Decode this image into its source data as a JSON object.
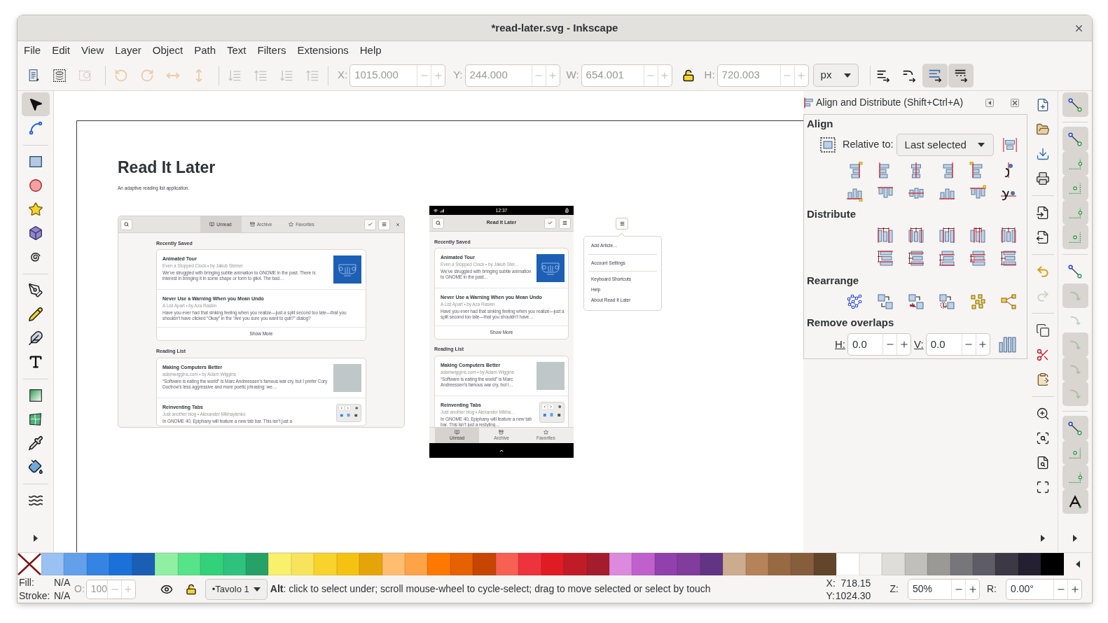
{
  "window": {
    "title": "*read-later.svg - Inkscape"
  },
  "menu": [
    "File",
    "Edit",
    "View",
    "Layer",
    "Object",
    "Path",
    "Text",
    "Filters",
    "Extensions",
    "Help"
  ],
  "toolbar": {
    "rotate_flip": {
      "disabled": true
    },
    "z_order": {
      "disabled": true
    },
    "fields": [
      {
        "label": "X:",
        "value": "1015.000"
      },
      {
        "label": "Y:",
        "value": "244.000"
      },
      {
        "label": "W:",
        "value": "654.001"
      },
      {
        "label": "H:",
        "value": "720.003"
      }
    ],
    "ratio_locked": false,
    "unit": "px",
    "transform_toggles": [
      {
        "on": false
      },
      {
        "on": false
      },
      {
        "on": true
      },
      {
        "on": true
      }
    ]
  },
  "tools": [
    {
      "selected": true
    },
    {
      "selected": false
    },
    {
      "selected": false
    },
    {
      "selected": false
    },
    {
      "selected": false
    },
    {
      "selected": false
    },
    {
      "selected": false
    },
    {
      "selected": false
    },
    {
      "selected": false
    },
    {
      "selected": false
    },
    {
      "selected": false
    },
    {
      "selected": false
    },
    {
      "selected": false
    },
    {
      "selected": false
    },
    {
      "selected": false
    },
    {
      "selected": false
    }
  ],
  "canvas": {
    "heading": "Read It Later",
    "subtitle": "An adaptive reading list application.",
    "desktop_mockup": {
      "tabs": [
        {
          "label": "Unread",
          "selected": true
        },
        {
          "label": "Archive",
          "selected": false
        },
        {
          "label": "Favorites",
          "selected": false
        }
      ],
      "sections": [
        {
          "title": "Recently Saved",
          "articles": [
            {
              "title": "Animated Tour",
              "meta": "Even a Stopped Clock • by Jakub Steiner",
              "excerpt": "We’ve struggled with bringing subtle animation to GNOME in the past. There is interest in bringing it in some shape or form to gtk4. The bad…",
              "thumbnail": {
                "kind": "illustration"
              }
            },
            {
              "title": "Never Use a Warning When you Mean Undo",
              "meta": "A List Apart • by Aza Raskin",
              "excerpt": "Have you ever had that sinking feeling when you realize—just a split second too late—that you shouldn’t have clicked “Okay” in the “Are you sure you want to quit?” dialog?"
            }
          ],
          "more": "Show More"
        },
        {
          "title": "Reading List",
          "articles": [
            {
              "title": "Making Computers Better",
              "meta": "adamwiggins.com • by Adam Wiggins",
              "excerpt": "“Software is eating the world” is Marc Andreessen’s famous war cry, but I prefer Cory Doctrow’s less aggressive and more poetic phrasing: we…",
              "thumbnail": {
                "kind": "photo"
              }
            },
            {
              "title": "Reinventing Tabs",
              "meta": "Just another blog • Alexander Mikhaylenko",
              "excerpt": "In GNOME 40, Epiphany will feature a new tab bar. This isn’t just a",
              "thumbnail": {
                "kind": "screenshot"
              }
            }
          ]
        }
      ]
    },
    "phone_mockup": {
      "time": "12:37",
      "title": "Read It Later",
      "sections": [
        {
          "title": "Recently Saved",
          "articles": [
            {
              "title": "Animated Tour",
              "meta": "Even a Stopped Clock • by Jakub Stei…",
              "excerpt": "We’ve struggled with bringing subtle animation to GNOME in the past…",
              "thumbnail": {
                "kind": "illustration"
              }
            },
            {
              "title": "Never Use a Warning When you Mean Undo",
              "meta": "A List Apart • by Aza Raskin",
              "excerpt": "Have you ever had that sinking feeling when you realize—just a split second too late—that you shouldn’t have…"
            }
          ],
          "more": "Show More"
        },
        {
          "title": "Reading List",
          "articles": [
            {
              "title": "Making Computers Better",
              "meta": "adamwiggins.com • by Adam Wiggins",
              "excerpt": "“Software is eating the world” is Marc Andreessen’s famous war cry, but I…",
              "thumbnail": {
                "kind": "photo"
              }
            },
            {
              "title": "Reinventing Tabs",
              "meta": "Just another blog • Alexander Mikha…",
              "excerpt": "In GNOME 40, Epiphany will feature a new tab bar. This isn’t just a restyling…",
              "thumbnail": {
                "kind": "screenshot"
              }
            }
          ]
        }
      ],
      "tabs": [
        {
          "label": "Unread",
          "selected": true
        },
        {
          "label": "Archive",
          "selected": false
        },
        {
          "label": "Favorites",
          "selected": false
        }
      ]
    },
    "popover_menu": {
      "groups": [
        [
          "Add Article…"
        ],
        [
          "Account Settings"
        ],
        [
          "Keyboard Shortcuts",
          "Help",
          "About Read It Later"
        ]
      ]
    }
  },
  "align_panel": {
    "title": "Align and Distribute (Shift+Ctrl+A)",
    "align_heading": "Align",
    "relative_label": "Relative to:",
    "relative_value": "Last selected",
    "distribute_heading": "Distribute",
    "rearrange_heading": "Rearrange",
    "overlaps_heading": "Remove overlaps",
    "h_label": "H:",
    "h_value": "0.0",
    "v_label": "V:",
    "v_value": "0.0"
  },
  "commands": [
    {
      "disabled": false
    },
    {
      "disabled": false
    },
    {
      "disabled": false
    },
    {
      "disabled": false
    },
    {
      "disabled": false
    },
    {
      "disabled": false
    },
    {
      "disabled": false
    },
    {
      "disabled": true
    },
    {
      "disabled": false
    },
    {
      "disabled": false
    },
    {
      "disabled": false
    },
    {
      "disabled": false
    },
    {
      "disabled": false
    },
    {
      "disabled": false
    },
    {
      "disabled": false
    }
  ],
  "snap": [
    {
      "on": true,
      "disabled": false
    },
    {
      "on": true,
      "disabled": false
    },
    {
      "on": true,
      "disabled": false
    },
    {
      "on": true,
      "disabled": false
    },
    {
      "on": true,
      "disabled": false
    },
    {
      "on": true,
      "disabled": false
    },
    {
      "on": false,
      "disabled": false
    },
    {
      "on": true,
      "disabled": true
    },
    {
      "on": false,
      "disabled": true
    },
    {
      "on": true,
      "disabled": true
    },
    {
      "on": true,
      "disabled": true
    },
    {
      "on": true,
      "disabled": true
    },
    {
      "on": true,
      "disabled": false
    },
    {
      "on": true,
      "disabled": false
    },
    {
      "on": true,
      "disabled": false
    },
    {
      "on": true,
      "disabled": false
    }
  ],
  "palette": {
    "swatches": [
      {
        "color": "#99c1f1"
      },
      {
        "color": "#62a0ea"
      },
      {
        "color": "#3584e4"
      },
      {
        "color": "#1c71d8"
      },
      {
        "color": "#1a5fb4"
      },
      {
        "color": "#8ff0a4"
      },
      {
        "color": "#57e389"
      },
      {
        "color": "#33d17a"
      },
      {
        "color": "#2ec27e"
      },
      {
        "color": "#26a269"
      },
      {
        "color": "#f9f06b"
      },
      {
        "color": "#f8e45c"
      },
      {
        "color": "#f6d32d"
      },
      {
        "color": "#f5c211"
      },
      {
        "color": "#e5a50a"
      },
      {
        "color": "#ffbe6f"
      },
      {
        "color": "#ffa348"
      },
      {
        "color": "#ff7800"
      },
      {
        "color": "#e66100"
      },
      {
        "color": "#c64600"
      },
      {
        "color": "#f66151"
      },
      {
        "color": "#ed333b"
      },
      {
        "color": "#e01b24"
      },
      {
        "color": "#c01c28"
      },
      {
        "color": "#a51d2d"
      },
      {
        "color": "#dc8add"
      },
      {
        "color": "#c061cb"
      },
      {
        "color": "#9141ac"
      },
      {
        "color": "#813d9c"
      },
      {
        "color": "#613583"
      },
      {
        "color": "#cdab8f"
      },
      {
        "color": "#b5835a"
      },
      {
        "color": "#986a44"
      },
      {
        "color": "#865e3c"
      },
      {
        "color": "#63452c"
      },
      {
        "color": "#ffffff"
      },
      {
        "color": "#f6f5f4"
      },
      {
        "color": "#deddda"
      },
      {
        "color": "#c0bfbc"
      },
      {
        "color": "#9a9996"
      },
      {
        "color": "#77767b"
      },
      {
        "color": "#5e5c64"
      },
      {
        "color": "#3d3846"
      },
      {
        "color": "#241f31"
      },
      {
        "color": "#000000"
      }
    ]
  },
  "status_bar": {
    "fill_label": "Fill:",
    "fill_value": "N/A",
    "stroke_label": "Stroke:",
    "stroke_value": "N/A",
    "opacity_label": "O:",
    "opacity_value": "100",
    "opacity_disabled": true,
    "layer_hidden": false,
    "layer_locked": false,
    "layer": "•Tavolo 1",
    "message": "**Alt**: click to select under; scroll mouse-wheel to cycle-select; drag to move selected or select by touch",
    "x_label": "X:",
    "x_value": "718.15",
    "y_label": "Y:",
    "y_value": "1024.30",
    "zoom_label": "Z:",
    "zoom_value": "50%",
    "rotate_label": "R:",
    "rotate_value": "0.00°"
  }
}
